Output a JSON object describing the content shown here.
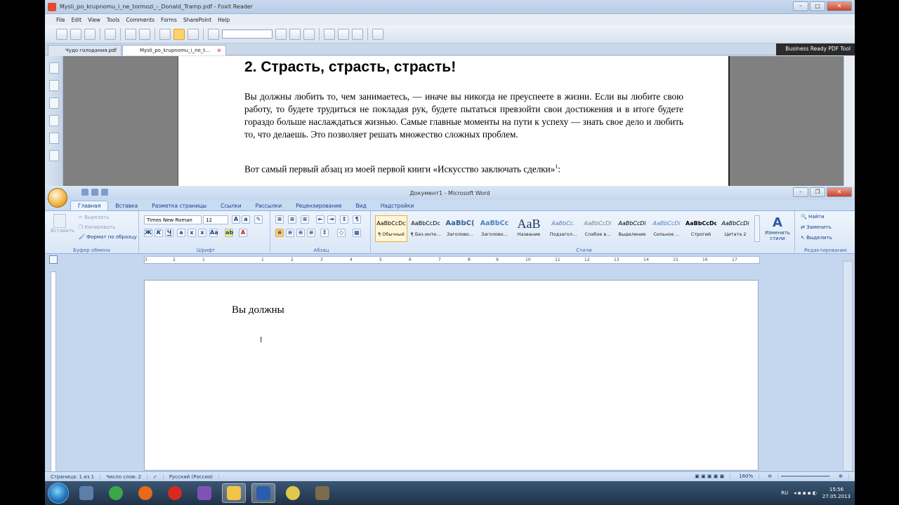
{
  "foxit": {
    "title": "Mysli_po_krupnomu_i_ne_tormozi_-_Donald_Tramp.pdf - Foxit Reader",
    "menu": [
      "File",
      "Edit",
      "View",
      "Tools",
      "Comments",
      "Forms",
      "SharePoint",
      "Help"
    ],
    "tabs": [
      {
        "label": "Чудо голодания.pdf"
      },
      {
        "label": "Mysli_po_krupnomu_i_ne_t..."
      }
    ],
    "brand": "Business Ready PDF Tool",
    "heading": "2. Страсть, страсть, страсть!",
    "paragraph1": "Вы должны любить то, чем занимаетесь, — иначе вы никогда не преуспеете в жизни. Если вы любите свою работу, то будете трудиться не покладая рук, будете пытаться превзойти свои достижения и в итоге будете гораздо больше наслаждаться жизнью. Самые главные моменты на пути к успеху — знать свое дело и любить то, что делаешь. Это позволяет решать множество сложных проблем.",
    "paragraph2": "Вот самый первый абзац из моей первой книги «Искусство заключать сделки»",
    "footnote": "1",
    "paragraph2_end": ":"
  },
  "word": {
    "title": "Документ1 - Microsoft Word",
    "tabs": [
      "Главная",
      "Вставка",
      "Разметка страницы",
      "Ссылки",
      "Рассылки",
      "Рецензирование",
      "Вид",
      "Надстройки"
    ],
    "clipboard": {
      "paste": "Вставить",
      "cut": "Вырезать",
      "copy": "Копировать",
      "format_painter": "Формат по образцу",
      "label": "Буфер обмена"
    },
    "font": {
      "name": "Times New Roman",
      "size": "12",
      "label": "Шрифт"
    },
    "paragraph_label": "Абзац",
    "styles": [
      {
        "preview": "AaBbCcDc",
        "name": "¶ Обычный"
      },
      {
        "preview": "AaBbCcDc",
        "name": "¶ Без инте..."
      },
      {
        "preview": "AaBbC(",
        "name": "Заголово..."
      },
      {
        "preview": "AaBbCc",
        "name": "Заголово..."
      },
      {
        "preview": "AaB",
        "name": "Название"
      },
      {
        "preview": "AaBbCc.",
        "name": "Подзагол..."
      },
      {
        "preview": "AaBbCcDi",
        "name": "Слабое в..."
      },
      {
        "preview": "AaBbCcDi",
        "name": "Выделение"
      },
      {
        "preview": "AaBbCcDi",
        "name": "Сильное ..."
      },
      {
        "preview": "AaBbCcDc",
        "name": "Строгий"
      },
      {
        "preview": "AaBbCcDi",
        "name": "Цитата 2"
      }
    ],
    "styles_label": "Стили",
    "change_styles": "Изменить стили",
    "editing": {
      "find": "Найти",
      "replace": "Заменить",
      "select": "Выделить",
      "label": "Редактирование"
    },
    "ruler_numbers": [
      "3",
      "2",
      "1",
      "1",
      "2",
      "3",
      "4",
      "5",
      "6",
      "7",
      "8",
      "9",
      "10",
      "11",
      "12",
      "13",
      "14",
      "15",
      "16",
      "17"
    ],
    "document_text": "Вы должны",
    "status": {
      "page": "Страница: 1 из 1",
      "words": "Число слов: 2",
      "language": "Русский (Россия)",
      "zoom": "160%"
    }
  },
  "taskbar": {
    "lang": "RU",
    "time": "15:56",
    "date": "27.05.2013",
    "apps": [
      {
        "name": "start-orb",
        "color": "#2a7fd0"
      },
      {
        "name": "desktop",
        "color": "#5c7fa8"
      },
      {
        "name": "chrome",
        "color": "#3ba74b"
      },
      {
        "name": "firefox",
        "color": "#e66a1a"
      },
      {
        "name": "opera",
        "color": "#d42a1f"
      },
      {
        "name": "media",
        "color": "#7d54b3"
      },
      {
        "name": "foxit",
        "color": "#f0c34a"
      },
      {
        "name": "word",
        "color": "#2b5dac"
      },
      {
        "name": "chat",
        "color": "#e0c84b"
      },
      {
        "name": "tool",
        "color": "#7a6c4b"
      }
    ]
  }
}
